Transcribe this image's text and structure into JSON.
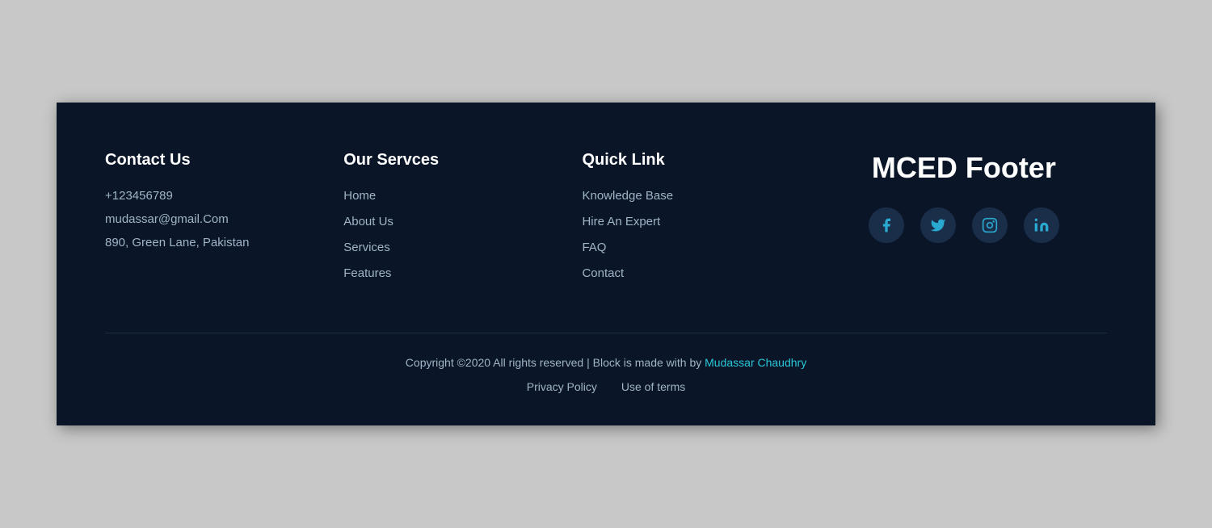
{
  "footer": {
    "contact": {
      "heading": "Contact Us",
      "phone": "+123456789",
      "email": "mudassar@gmail.Com",
      "address": "890, Green Lane, Pakistan"
    },
    "services": {
      "heading": "Our Servces",
      "links": [
        {
          "label": "Home",
          "href": "#"
        },
        {
          "label": "About Us",
          "href": "#"
        },
        {
          "label": "Services",
          "href": "#"
        },
        {
          "label": "Features",
          "href": "#"
        }
      ]
    },
    "quicklinks": {
      "heading": "Quick Link",
      "links": [
        {
          "label": "Knowledge Base",
          "href": "#"
        },
        {
          "label": "Hire An Expert",
          "href": "#"
        },
        {
          "label": "FAQ",
          "href": "#"
        },
        {
          "label": "Contact",
          "href": "#"
        }
      ]
    },
    "brand": {
      "title": "MCED Footer",
      "socials": [
        {
          "name": "facebook",
          "icon": "f"
        },
        {
          "name": "twitter",
          "icon": "t"
        },
        {
          "name": "instagram",
          "icon": "i"
        },
        {
          "name": "linkedin",
          "icon": "in"
        }
      ]
    },
    "bottom": {
      "copyright": "Copyright ©2020 All rights reserved | Block is made with by",
      "author": "Mudassar Chaudhry",
      "author_href": "#",
      "privacy_policy": "Privacy Policy",
      "use_of_terms": "Use of terms"
    }
  }
}
